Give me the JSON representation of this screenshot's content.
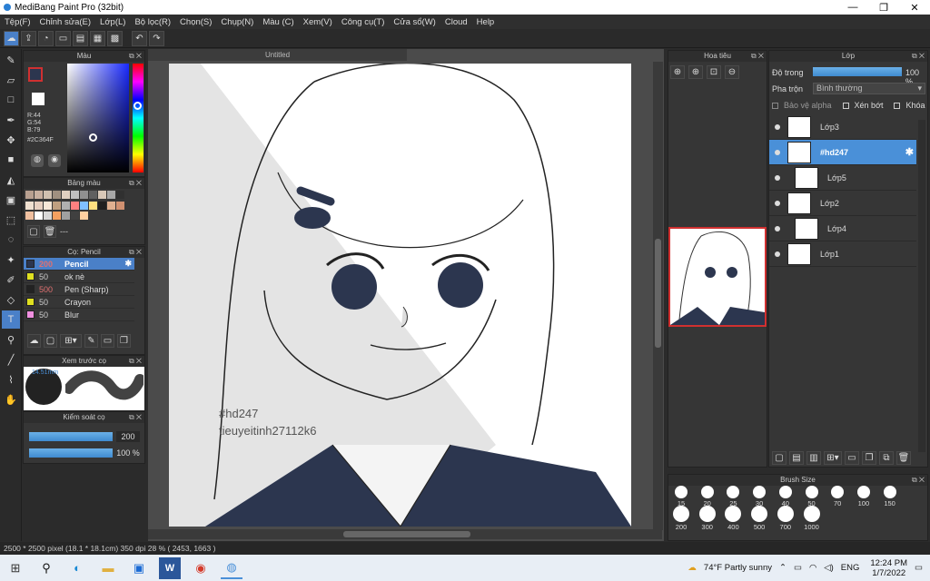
{
  "window": {
    "title": "MediBang Paint Pro (32bit)"
  },
  "menu": [
    "Tệp(F)",
    "Chỉnh sửa(E)",
    "Lớp(L)",
    "Bộ lọc(R)",
    "Chọn(S)",
    "Chụp(N)",
    "Màu (C)",
    "Xem(V)",
    "Công cụ(T)",
    "Cửa sổ(W)",
    "Cloud",
    "Help"
  ],
  "color_panel": {
    "title": "Màu",
    "r": "R:44",
    "g": "G:54",
    "b": "B:79",
    "hex": "#2C364F",
    "fg_color": "#2c364f"
  },
  "palette_panel": {
    "title": "Bảng màu",
    "placeholder": "---"
  },
  "brush_panel": {
    "title": "Cọ: Pencil",
    "items": [
      {
        "size": "200",
        "name": "Pencil",
        "color": "#2c364f",
        "selected": true
      },
      {
        "size": "50",
        "name": "ok nè",
        "color": "#e0e020"
      },
      {
        "size": "500",
        "name": "Pen (Sharp)",
        "color": "#222222"
      },
      {
        "size": "50",
        "name": "Crayon",
        "color": "#e0e020"
      },
      {
        "size": "50",
        "name": "Blur",
        "color": "#f090e0"
      }
    ]
  },
  "preview_panel": {
    "title": "Xem trước cọ",
    "size": "14.51mm"
  },
  "control_panel": {
    "title": "Kiểm soát cọ",
    "size_value": "200",
    "opacity_value": "100 %"
  },
  "document": {
    "tab": "Untitled",
    "watermark_line1": "#hd247",
    "watermark_line2": "tieuyeitinh27112k6"
  },
  "navigator": {
    "title": "Hoa tiêu"
  },
  "layer_panel": {
    "title": "Lớp",
    "opacity_label": "Độ trong",
    "opacity_value": "100 %",
    "opacity_fraction": 1.0,
    "blend_label": "Pha trộn",
    "blend_value": "Bình thường",
    "protect_alpha": "Bảo vệ alpha",
    "clipping": "Xén bớt",
    "lock": "Khóa",
    "layers": [
      {
        "name": "Lớp3",
        "selected": false,
        "indent": false
      },
      {
        "name": "#hd247",
        "selected": true,
        "indent": false
      },
      {
        "name": "Lớp5",
        "selected": false,
        "indent": true
      },
      {
        "name": "Lớp2",
        "selected": false,
        "indent": false
      },
      {
        "name": "Lớp4",
        "selected": false,
        "indent": true
      },
      {
        "name": "Lớp1",
        "selected": false,
        "indent": false
      }
    ]
  },
  "brush_size_panel": {
    "title": "Brush Size",
    "row1": [
      "15",
      "20",
      "25",
      "30",
      "40",
      "50",
      "70",
      "100",
      "150"
    ],
    "row2": [
      "200",
      "300",
      "400",
      "500",
      "700",
      "1000"
    ]
  },
  "status": {
    "text": "2500 * 2500 pixel  (18.1 * 18.1cm)  350 dpi  28 %  ( 2453, 1663 )"
  },
  "taskbar": {
    "weather": "74°F  Partly sunny",
    "lang": "ENG",
    "time": "12:24 PM",
    "date": "1/7/2022"
  }
}
